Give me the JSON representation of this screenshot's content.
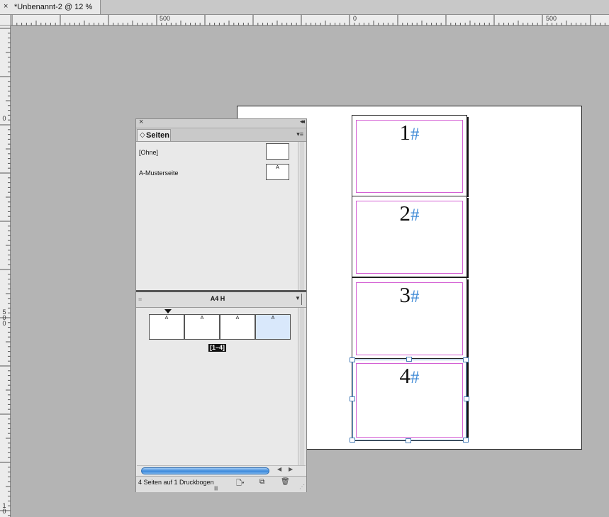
{
  "document_tab": {
    "close_glyph": "×",
    "title": "*Unbenannt-2 @ 12 %"
  },
  "ruler": {
    "horizontal_labels": [
      "500",
      "0",
      "500"
    ],
    "vertical_labels": [
      "0",
      "5\n0\n0",
      "1\n0"
    ]
  },
  "pages_panel": {
    "close_glyph": "×",
    "collapse_glyph": "◂◂",
    "tab_label": "Seiten",
    "tab_arrow": "◇",
    "menu_glyph": "▾≡",
    "masters": [
      {
        "label": "[Ohne]",
        "thumb_letter": ""
      },
      {
        "label": "A-Musterseite",
        "thumb_letter": "A"
      }
    ],
    "page_size": "A4 H",
    "page_thumbnails": [
      {
        "letter": "A",
        "selected": false
      },
      {
        "letter": "A",
        "selected": false
      },
      {
        "letter": "A",
        "selected": false
      },
      {
        "letter": "A",
        "selected": true
      }
    ],
    "spread_label": "[1–4]",
    "footer_status": "4 Seiten auf 1 Druckbogen",
    "icons": [
      "page-size-icon",
      "new-page-icon",
      "trash-icon"
    ]
  },
  "document_pages": [
    {
      "number": "1",
      "marker": "#"
    },
    {
      "number": "2",
      "marker": "#"
    },
    {
      "number": "3",
      "marker": "#"
    },
    {
      "number": "4",
      "marker": "#"
    }
  ],
  "colors": {
    "margin_guide": "#d45fd4",
    "selection": "#6fa3d6",
    "page_marker": "#3f8ad6",
    "pasteboard": "#b4b4b4"
  }
}
